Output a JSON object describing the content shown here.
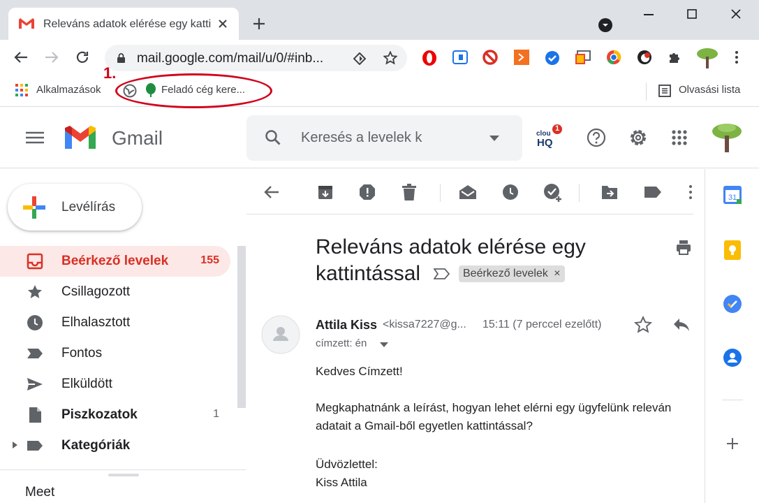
{
  "browser": {
    "tab_title": "Releváns adatok elérése egy kattintással - Gmail",
    "url": "mail.google.com/mail/u/0/#inb...",
    "bookmarks": {
      "apps": "Alkalmazások",
      "item": "Feladó cég kere...",
      "reading_list": "Olvasási lista"
    }
  },
  "annotation": {
    "number": "1."
  },
  "gmail": {
    "product": "Gmail",
    "search_placeholder": "Keresés a levelek k",
    "compose": "Levélírás",
    "nav": [
      {
        "label": "Beérkező levelek",
        "count": "155"
      },
      {
        "label": "Csillagozott",
        "count": ""
      },
      {
        "label": "Elhalasztott",
        "count": ""
      },
      {
        "label": "Fontos",
        "count": ""
      },
      {
        "label": "Elküldött",
        "count": ""
      },
      {
        "label": "Piszkozatok",
        "count": "1"
      },
      {
        "label": "Kategóriák",
        "count": ""
      }
    ],
    "meet": "Meet",
    "extension_badge": "1",
    "extension_name": "cloud HQ"
  },
  "email": {
    "subject": "Releváns adatok elérése egy kattintással",
    "label": "Beérkező levelek",
    "sender_name": "Attila Kiss",
    "sender_email": "<kissa7227@g...",
    "time": "15:11 (7 perccel ezelőtt)",
    "to": "címzett: én",
    "greeting": "Kedves Címzett!",
    "body_1": "Megkaphatnánk a leírást, hogyan lehet elérni egy ügyfelünk releván",
    "body_2": "adatait a Gmail-ből egyetlen kattintással?",
    "closing": "Üdvözlettel:",
    "signature": "Kiss Attila"
  },
  "colors": {
    "accent_red": "#d93025",
    "annotation": "#d0021b",
    "inbox_bg": "#fce8e6"
  }
}
